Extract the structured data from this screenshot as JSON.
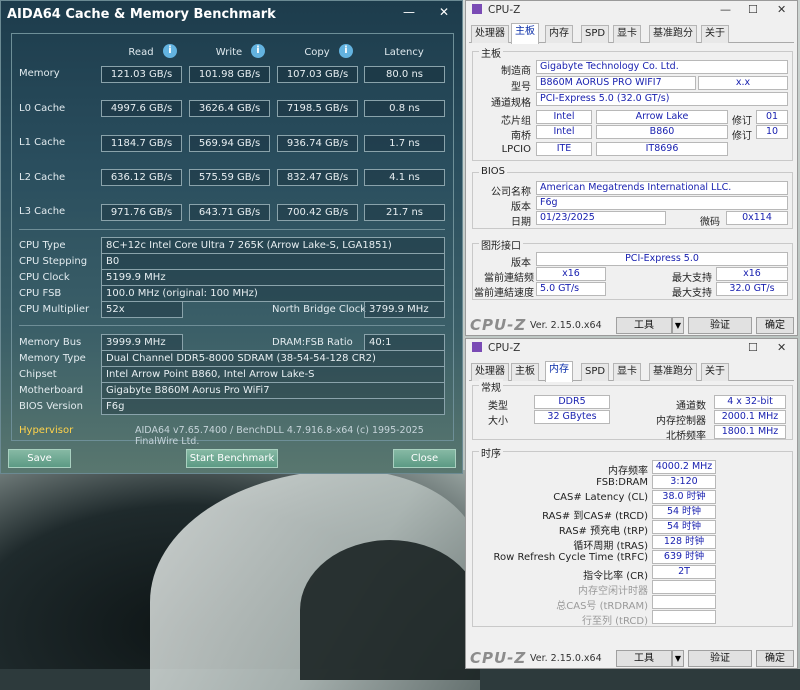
{
  "aida": {
    "title": "AIDA64 Cache & Memory Benchmark",
    "minimize": "—",
    "close": "✕",
    "columns": [
      "Read",
      "Write",
      "Copy",
      "Latency"
    ],
    "info_glyph": "i",
    "rows": [
      {
        "label": "Memory",
        "values": [
          "121.03 GB/s",
          "101.98 GB/s",
          "107.03 GB/s",
          "80.0 ns"
        ]
      },
      {
        "label": "L0 Cache",
        "values": [
          "4997.6 GB/s",
          "3626.4 GB/s",
          "7198.5 GB/s",
          "0.8 ns"
        ]
      },
      {
        "label": "L1 Cache",
        "values": [
          "1184.7 GB/s",
          "569.94 GB/s",
          "936.74 GB/s",
          "1.7 ns"
        ]
      },
      {
        "label": "L2 Cache",
        "values": [
          "636.12 GB/s",
          "575.59 GB/s",
          "832.47 GB/s",
          "4.1 ns"
        ]
      },
      {
        "label": "L3 Cache",
        "values": [
          "971.76 GB/s",
          "643.71 GB/s",
          "700.42 GB/s",
          "21.7 ns"
        ]
      }
    ],
    "cpu_type_label": "CPU Type",
    "cpu_type": "8C+12c Intel Core Ultra 7 265K  (Arrow Lake-S, LGA1851)",
    "cpu_stepping_label": "CPU Stepping",
    "cpu_stepping": "B0",
    "cpu_clock_label": "CPU Clock",
    "cpu_clock": "5199.9 MHz",
    "cpu_fsb_label": "CPU FSB",
    "cpu_fsb": "100.0 MHz  (original: 100 MHz)",
    "cpu_multiplier_label": "CPU Multiplier",
    "cpu_multiplier": "52x",
    "nb_clock_label": "North Bridge Clock",
    "nb_clock": "3799.9 MHz",
    "mem_bus_label": "Memory Bus",
    "mem_bus": "3999.9 MHz",
    "dram_ratio_label": "DRAM:FSB Ratio",
    "dram_ratio": "40:1",
    "mem_type_label": "Memory Type",
    "mem_type": "Dual Channel DDR5-8000 SDRAM  (38-54-54-128 CR2)",
    "chipset_label": "Chipset",
    "chipset": "Intel Arrow Point B860, Intel Arrow Lake-S",
    "motherboard_label": "Motherboard",
    "motherboard": "Gigabyte B860M Aorus Pro WiFi7",
    "bios_label": "BIOS Version",
    "bios": "F6g",
    "hypervisor": "Hypervisor",
    "copyright": "AIDA64 v7.65.7400 / BenchDLL 4.7.916.8-x64  (c) 1995-2025 FinalWire Ltd.",
    "save": "Save",
    "start": "Start Benchmark",
    "close_btn": "Close"
  },
  "cpuz_common": {
    "title": "CPU-Z",
    "minimize": "—",
    "maximize": "☐",
    "close": "✕",
    "tabs": [
      "处理器",
      "主板",
      "内存",
      "SPD",
      "显卡",
      "基准跑分",
      "关于"
    ],
    "logo": "CPU-Z",
    "version": "Ver. 2.15.0.x64",
    "tools": "工具",
    "dropdown": "▼",
    "validate": "验证",
    "ok": "确定"
  },
  "mainboard": {
    "group_board": "主板",
    "manufacturer_label": "制造商",
    "manufacturer": "Gigabyte Technology Co. Ltd.",
    "model_label": "型号",
    "model": "B860M AORUS PRO WIFI7",
    "model_rev": "x.x",
    "bus_label": "通道规格",
    "bus": "PCI-Express 5.0 (32.0 GT/s)",
    "chipset_label": "芯片组",
    "chipset_vendor": "Intel",
    "chipset_name": "Arrow Lake",
    "rev_label": "修订",
    "chipset_rev": "01",
    "southbridge_label": "南桥",
    "sb_vendor": "Intel",
    "sb_name": "B860",
    "sb_rev": "10",
    "lpcio_label": "LPCIO",
    "lpcio_vendor": "ITE",
    "lpcio_name": "IT8696",
    "group_bios": "BIOS",
    "bios_brand_label": "公司名称",
    "bios_brand": "American Megatrends International LLC.",
    "bios_version_label": "版本",
    "bios_version": "F6g",
    "bios_date_label": "日期",
    "bios_date": "01/23/2025",
    "microcode_label": "微码",
    "microcode": "0x114",
    "group_graphics": "图形接口",
    "gfx_version_label": "版本",
    "gfx_version": "PCI-Express 5.0",
    "link_width_label": "當前連結频",
    "link_width": "x16",
    "max_width_label": "最大支持",
    "max_width": "x16",
    "link_speed_label": "當前連結速度",
    "link_speed": "5.0 GT/s",
    "max_speed_label": "最大支持",
    "max_speed": "32.0 GT/s"
  },
  "memory": {
    "group_general": "常规",
    "type_label": "类型",
    "type": "DDR5",
    "channels_label": "通道数",
    "channels": "4 x 32-bit",
    "size_label": "大小",
    "size": "32 GBytes",
    "mc_freq_label": "内存控制器",
    "mc_freq": "2000.1 MHz",
    "nb_freq_label": "北桥频率",
    "nb_freq": "1800.1 MHz",
    "group_timings": "时序",
    "timings": [
      {
        "label": "内存频率",
        "value": "4000.2 MHz",
        "dim": false
      },
      {
        "label": "FSB:DRAM",
        "value": "3:120",
        "dim": false
      },
      {
        "label": "CAS# Latency (CL)",
        "value": "38.0 时钟",
        "dim": false
      },
      {
        "label": "RAS# 到CAS# (tRCD)",
        "value": "54 时钟",
        "dim": false
      },
      {
        "label": "RAS# 预充电 (tRP)",
        "value": "54 时钟",
        "dim": false
      },
      {
        "label": "循环周期 (tRAS)",
        "value": "128 时钟",
        "dim": false
      },
      {
        "label": "Row Refresh Cycle Time (tRFC)",
        "value": "639 时钟",
        "dim": false
      },
      {
        "label": "指令比率 (CR)",
        "value": "2T",
        "dim": false
      },
      {
        "label": "内存空闲计时器",
        "value": "",
        "dim": true
      },
      {
        "label": "总CAS号 (tRDRAM)",
        "value": "",
        "dim": true
      },
      {
        "label": "行至列 (tRCD)",
        "value": "",
        "dim": true
      }
    ]
  }
}
